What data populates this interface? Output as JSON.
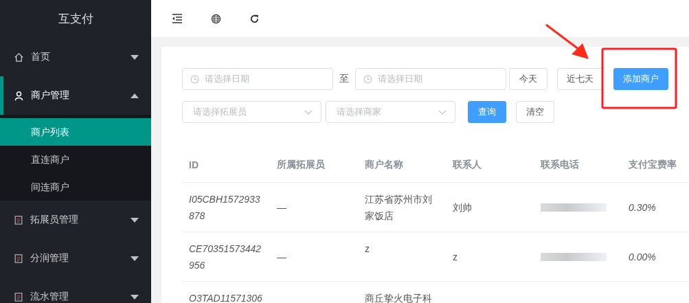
{
  "app": {
    "logo": "互支付"
  },
  "sidebar": {
    "items": [
      {
        "label": "首页",
        "kind": "home",
        "expanded": false,
        "selected": false
      },
      {
        "label": "商户管理",
        "kind": "user",
        "expanded": true,
        "selected": true,
        "children": [
          {
            "label": "商户列表",
            "selected": true
          },
          {
            "label": "直连商户",
            "selected": false
          },
          {
            "label": "间连商户",
            "selected": false
          }
        ]
      },
      {
        "label": "拓展员管理",
        "kind": "clipboard",
        "expanded": false,
        "selected": false
      },
      {
        "label": "分润管理",
        "kind": "clipboard",
        "expanded": false,
        "selected": false
      },
      {
        "label": "流水管理",
        "kind": "clipboard",
        "expanded": false,
        "selected": false
      }
    ]
  },
  "filters": {
    "start_date": {
      "placeholder": "请选择日期"
    },
    "separator": "至",
    "end_date": {
      "placeholder": "请选择日期"
    },
    "range_buttons": [
      {
        "label": "今天",
        "kind": "default"
      },
      {
        "label": "近七天",
        "kind": "default"
      }
    ],
    "add_button": {
      "label": "添加商户",
      "kind": "primary"
    },
    "expander_select": {
      "placeholder": "请选择拓展员"
    },
    "merchant_select": {
      "placeholder": "请选择商家"
    },
    "action_buttons": [
      {
        "label": "查询",
        "kind": "primary"
      },
      {
        "label": "清空",
        "kind": "default"
      }
    ]
  },
  "table": {
    "columns": [
      "ID",
      "所属拓展员",
      "商户名称",
      "联系人",
      "联系电话",
      "支付宝费率"
    ],
    "rows": [
      {
        "id": "I05CBH1572933878",
        "expander": "—",
        "name": "江苏省苏州市刘家饭店",
        "contact": "刘帅",
        "phone_masked": true,
        "rate": "0.30%"
      },
      {
        "id": "CE70351573442956",
        "expander": "—",
        "name": "z",
        "contact": "z",
        "phone_masked": true,
        "rate": "0.00%"
      },
      {
        "id": "O3TAD11571306",
        "name": "商丘挚火电子科"
      }
    ]
  }
}
